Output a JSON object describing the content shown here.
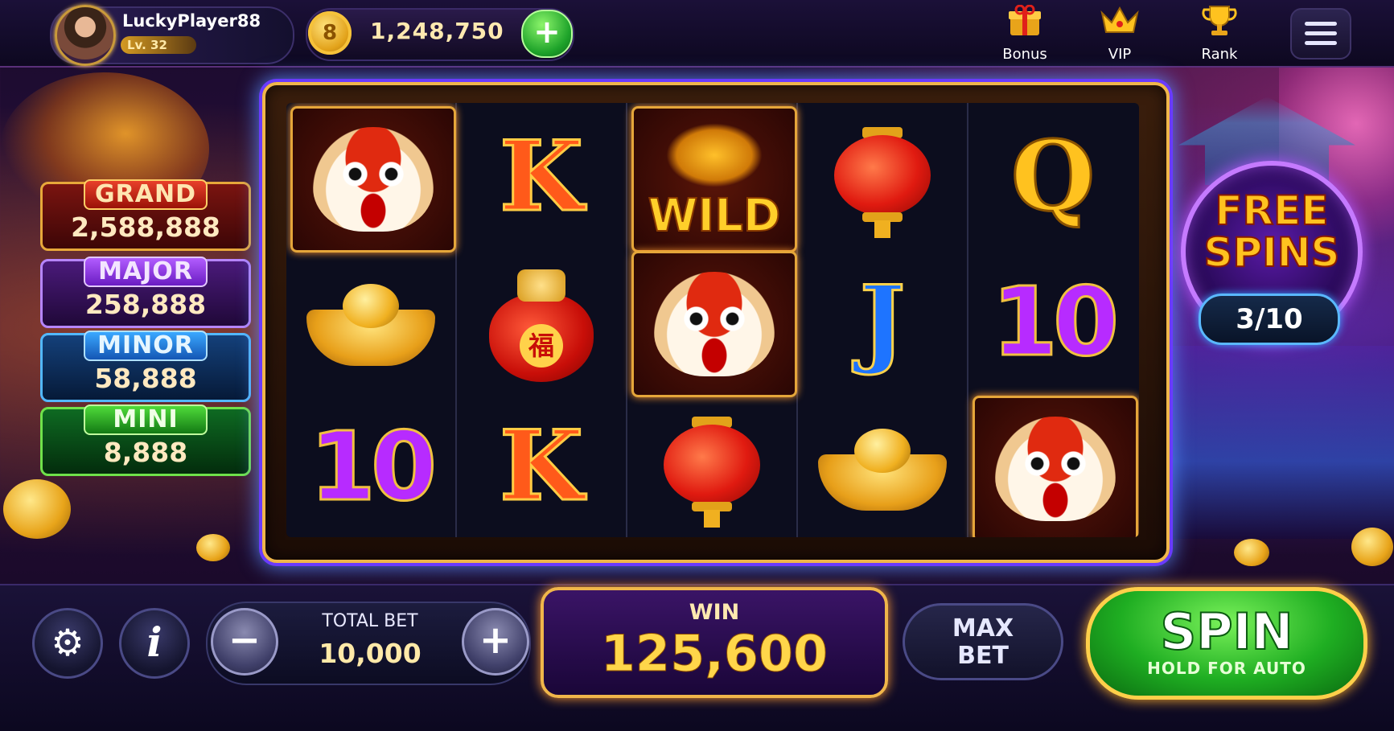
{
  "player": {
    "name": "LuckyPlayer88",
    "level": "Lv. 32"
  },
  "balance": {
    "coins": "1,248,750",
    "coin_glyph": "8",
    "add_glyph": "+"
  },
  "nav": [
    {
      "label": "Bonus",
      "icon": "gift-icon"
    },
    {
      "label": "VIP",
      "icon": "crown-icon"
    },
    {
      "label": "Rank",
      "icon": "trophy-icon"
    }
  ],
  "jackpots": {
    "grand": {
      "name": "GRAND",
      "value": "2,588,888"
    },
    "major": {
      "name": "MAJOR",
      "value": "258,888"
    },
    "minor": {
      "name": "MINOR",
      "value": "58,888"
    },
    "mini": {
      "name": "MINI",
      "value": "8,888"
    }
  },
  "reels": [
    [
      "lion-dance",
      "gold-ingot",
      "10"
    ],
    [
      "K",
      "lucky-bag",
      "K"
    ],
    [
      "wild-dragon",
      "lion-dance",
      "lantern"
    ],
    [
      "lantern",
      "J",
      "gold-ingot"
    ],
    [
      "Q",
      "10",
      "lion-dance"
    ]
  ],
  "symbol_text": {
    "wild": "WILD",
    "fu": "福"
  },
  "free_spins": {
    "line1": "FREE",
    "line2": "SPINS",
    "count": "3/10"
  },
  "controls": {
    "total_bet_label": "TOTAL BET",
    "total_bet_value": "10,000",
    "minus": "−",
    "plus": "+",
    "info": "i",
    "settings_glyph": "⚙",
    "win_label": "WIN",
    "win_value": "125,600",
    "max_bet_line1": "MAX",
    "max_bet_line2": "BET",
    "spin_label": "SPIN",
    "spin_sub": "HOLD FOR AUTO"
  },
  "colors": {
    "accent_gold": "#f0b64a",
    "spin_green": "#1fae22",
    "frame_glow": "#6a3aff"
  }
}
